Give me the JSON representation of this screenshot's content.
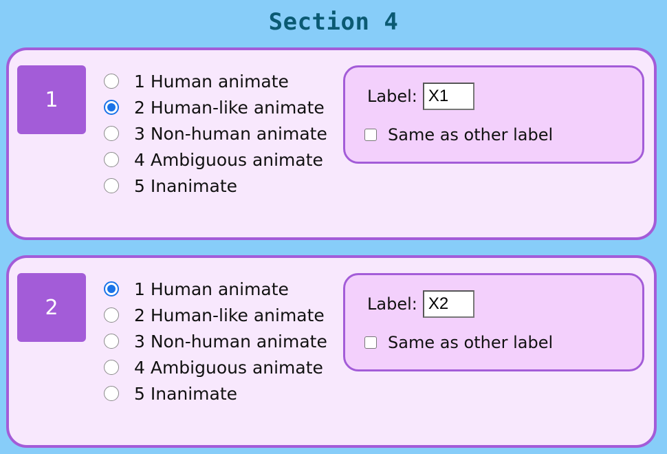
{
  "section": {
    "title": "Section 4"
  },
  "cards": [
    {
      "number": "1",
      "options": [
        {
          "label": "1 Human animate",
          "checked": false
        },
        {
          "label": "2 Human-like animate",
          "checked": true
        },
        {
          "label": "3 Non-human animate",
          "checked": false
        },
        {
          "label": "4 Ambiguous animate",
          "checked": false
        },
        {
          "label": "5 Inanimate",
          "checked": false
        }
      ],
      "label_text": "Label:",
      "label_value": "X1",
      "same_label_text": "Same as other label",
      "same_label_checked": false
    },
    {
      "number": "2",
      "options": [
        {
          "label": "1 Human animate",
          "checked": true
        },
        {
          "label": "2 Human-like animate",
          "checked": false
        },
        {
          "label": "3 Non-human animate",
          "checked": false
        },
        {
          "label": "4 Ambiguous animate",
          "checked": false
        },
        {
          "label": "5 Inanimate",
          "checked": false
        }
      ],
      "label_text": "Label:",
      "label_value": "X2",
      "same_label_text": "Same as other label",
      "same_label_checked": false
    }
  ],
  "colors": {
    "background": "#87cdf9",
    "title": "#0b5a73",
    "accent": "#a35cd8",
    "card_bg": "#f8e8fd",
    "panel_bg": "#f3d0fc",
    "radio_selected": "#1a73e8"
  }
}
